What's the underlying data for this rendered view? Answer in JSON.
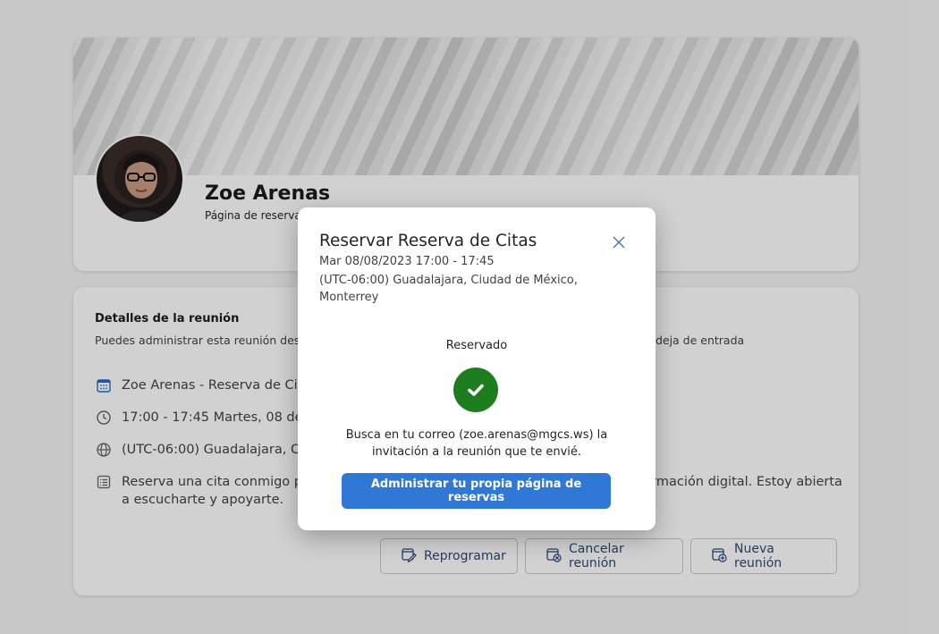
{
  "profile": {
    "name": "Zoe Arenas",
    "subtitle": "Página de reservas"
  },
  "details": {
    "title": "Detalles de la reunión",
    "description": "Puedes administrar esta reunión desde aquí o desde la invitación a la reunión que se envió a tu bandeja de entrada",
    "service": "Zoe Arenas - Reserva de Citas",
    "time": "17:00 - 17:45 Martes, 08 de agosto de 2023",
    "timezone": "(UTC-06:00) Guadalajara, Ciudad de México, Monterrey",
    "notes": "Reserva una cita conmigo para platicar sobre cómo puedo ayudarte en tu transformación digital. Estoy abierta a escucharte y apoyarte."
  },
  "actions": {
    "reschedule": "Reprogramar",
    "cancel": "Cancelar reunión",
    "new": "Nueva reunión"
  },
  "dialog": {
    "title": "Reservar Reserva de Citas",
    "date": "Mar 08/08/2023 17:00 - 17:45",
    "timezone": "(UTC-06:00) Guadalajara, Ciudad de México, Monterrey",
    "status": "Reservado",
    "message": "Busca en tu correo (zoe.arenas@mgcs.ws) la invitación a la reunión que te envié.",
    "primary_button": "Administrar tu propia página de reservas"
  },
  "colors": {
    "success": "#1e7d1e",
    "primary": "#2f78d6",
    "action_text": "#2b4a7a"
  }
}
